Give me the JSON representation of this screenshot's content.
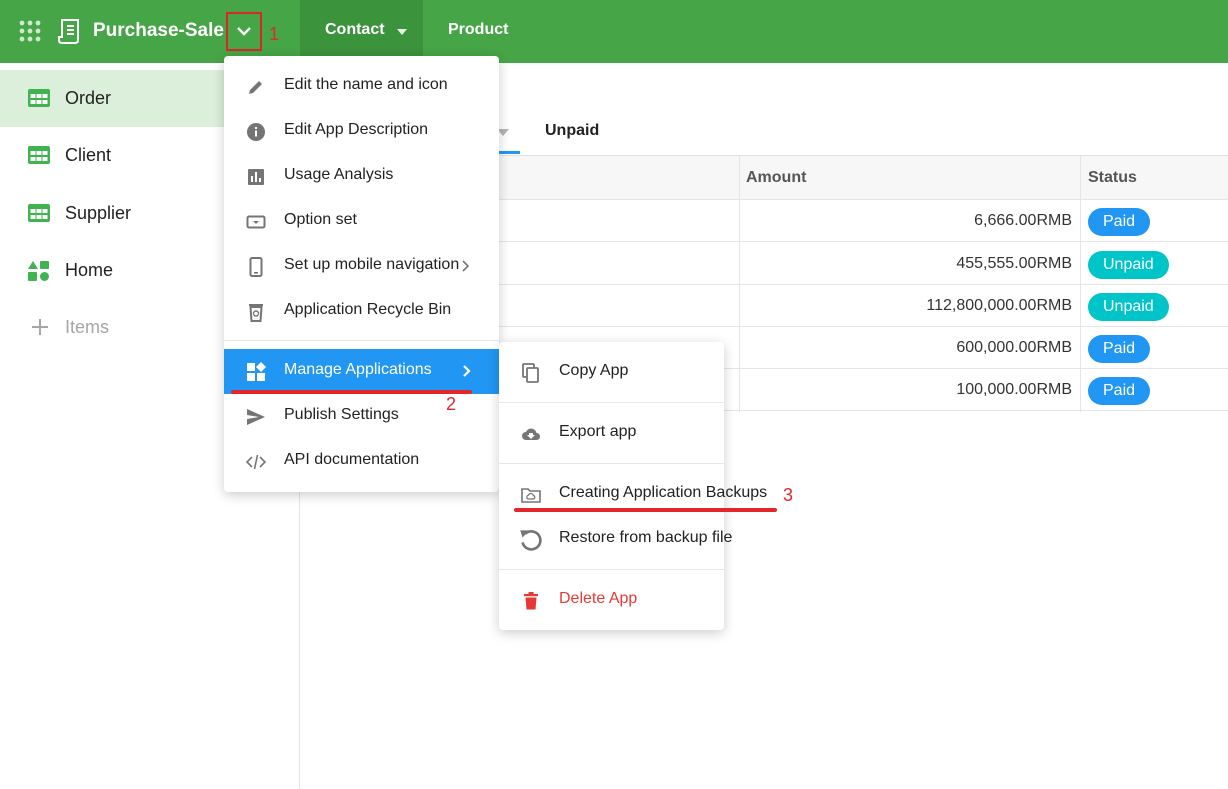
{
  "header": {
    "app_name": "Purchase-Sale",
    "nav": [
      {
        "label": "Contact",
        "icon": "caret-down-icon"
      },
      {
        "label": "Product"
      }
    ],
    "colors": {
      "bar": "#46a546",
      "active_nav": "#3b933b"
    }
  },
  "annotations": [
    "1",
    "2",
    "3"
  ],
  "sidebar": {
    "items": [
      {
        "label": "Order",
        "icon": "table-icon",
        "active": true
      },
      {
        "label": "Client",
        "icon": "table-icon"
      },
      {
        "label": "Supplier",
        "icon": "table-icon"
      },
      {
        "label": "Home",
        "icon": "shapes-icon"
      },
      {
        "label": "Items",
        "icon": "plus-icon"
      }
    ]
  },
  "tabs": {
    "second": "Unpaid"
  },
  "table": {
    "headers": {
      "amount": "Amount",
      "status": "Status"
    },
    "rows": [
      {
        "amount": "6,666.00RMB",
        "status": "Paid"
      },
      {
        "amount": "455,555.00RMB",
        "status": "Unpaid"
      },
      {
        "amount": "112,800,000.00RMB",
        "status": "Unpaid"
      },
      {
        "amount": "600,000.00RMB",
        "status": "Paid"
      },
      {
        "amount": "100,000.00RMB",
        "status": "Paid"
      }
    ],
    "status_colors": {
      "Paid": "#2196f3",
      "Unpaid": "#00c5c8"
    }
  },
  "app_menu": {
    "items": [
      {
        "label": "Edit the name and icon",
        "icon": "pencil-icon"
      },
      {
        "label": "Edit App Description",
        "icon": "info-icon"
      },
      {
        "label": "Usage Analysis",
        "icon": "bar-chart-icon"
      },
      {
        "label": "Option set",
        "icon": "option-set-icon"
      },
      {
        "label": "Set up mobile navigation",
        "icon": "mobile-icon"
      },
      {
        "label": "Application Recycle Bin",
        "icon": "recycle-bin-icon"
      },
      {
        "label": "Manage Applications",
        "icon": "widgets-icon",
        "active": true
      },
      {
        "label": "Publish Settings",
        "icon": "send-icon"
      },
      {
        "label": "API documentation",
        "icon": "code-icon"
      }
    ]
  },
  "manage_submenu": {
    "items": [
      {
        "label": "Copy App",
        "icon": "copy-icon"
      },
      {
        "label": "Export app",
        "icon": "cloud-download-icon"
      },
      {
        "label": "Creating Application Backups",
        "icon": "folder-cloud-icon"
      },
      {
        "label": "Restore from backup file",
        "icon": "undo-icon"
      },
      {
        "label": "Delete App",
        "icon": "trash-icon",
        "danger": true
      }
    ],
    "danger_color": "#e53935"
  }
}
